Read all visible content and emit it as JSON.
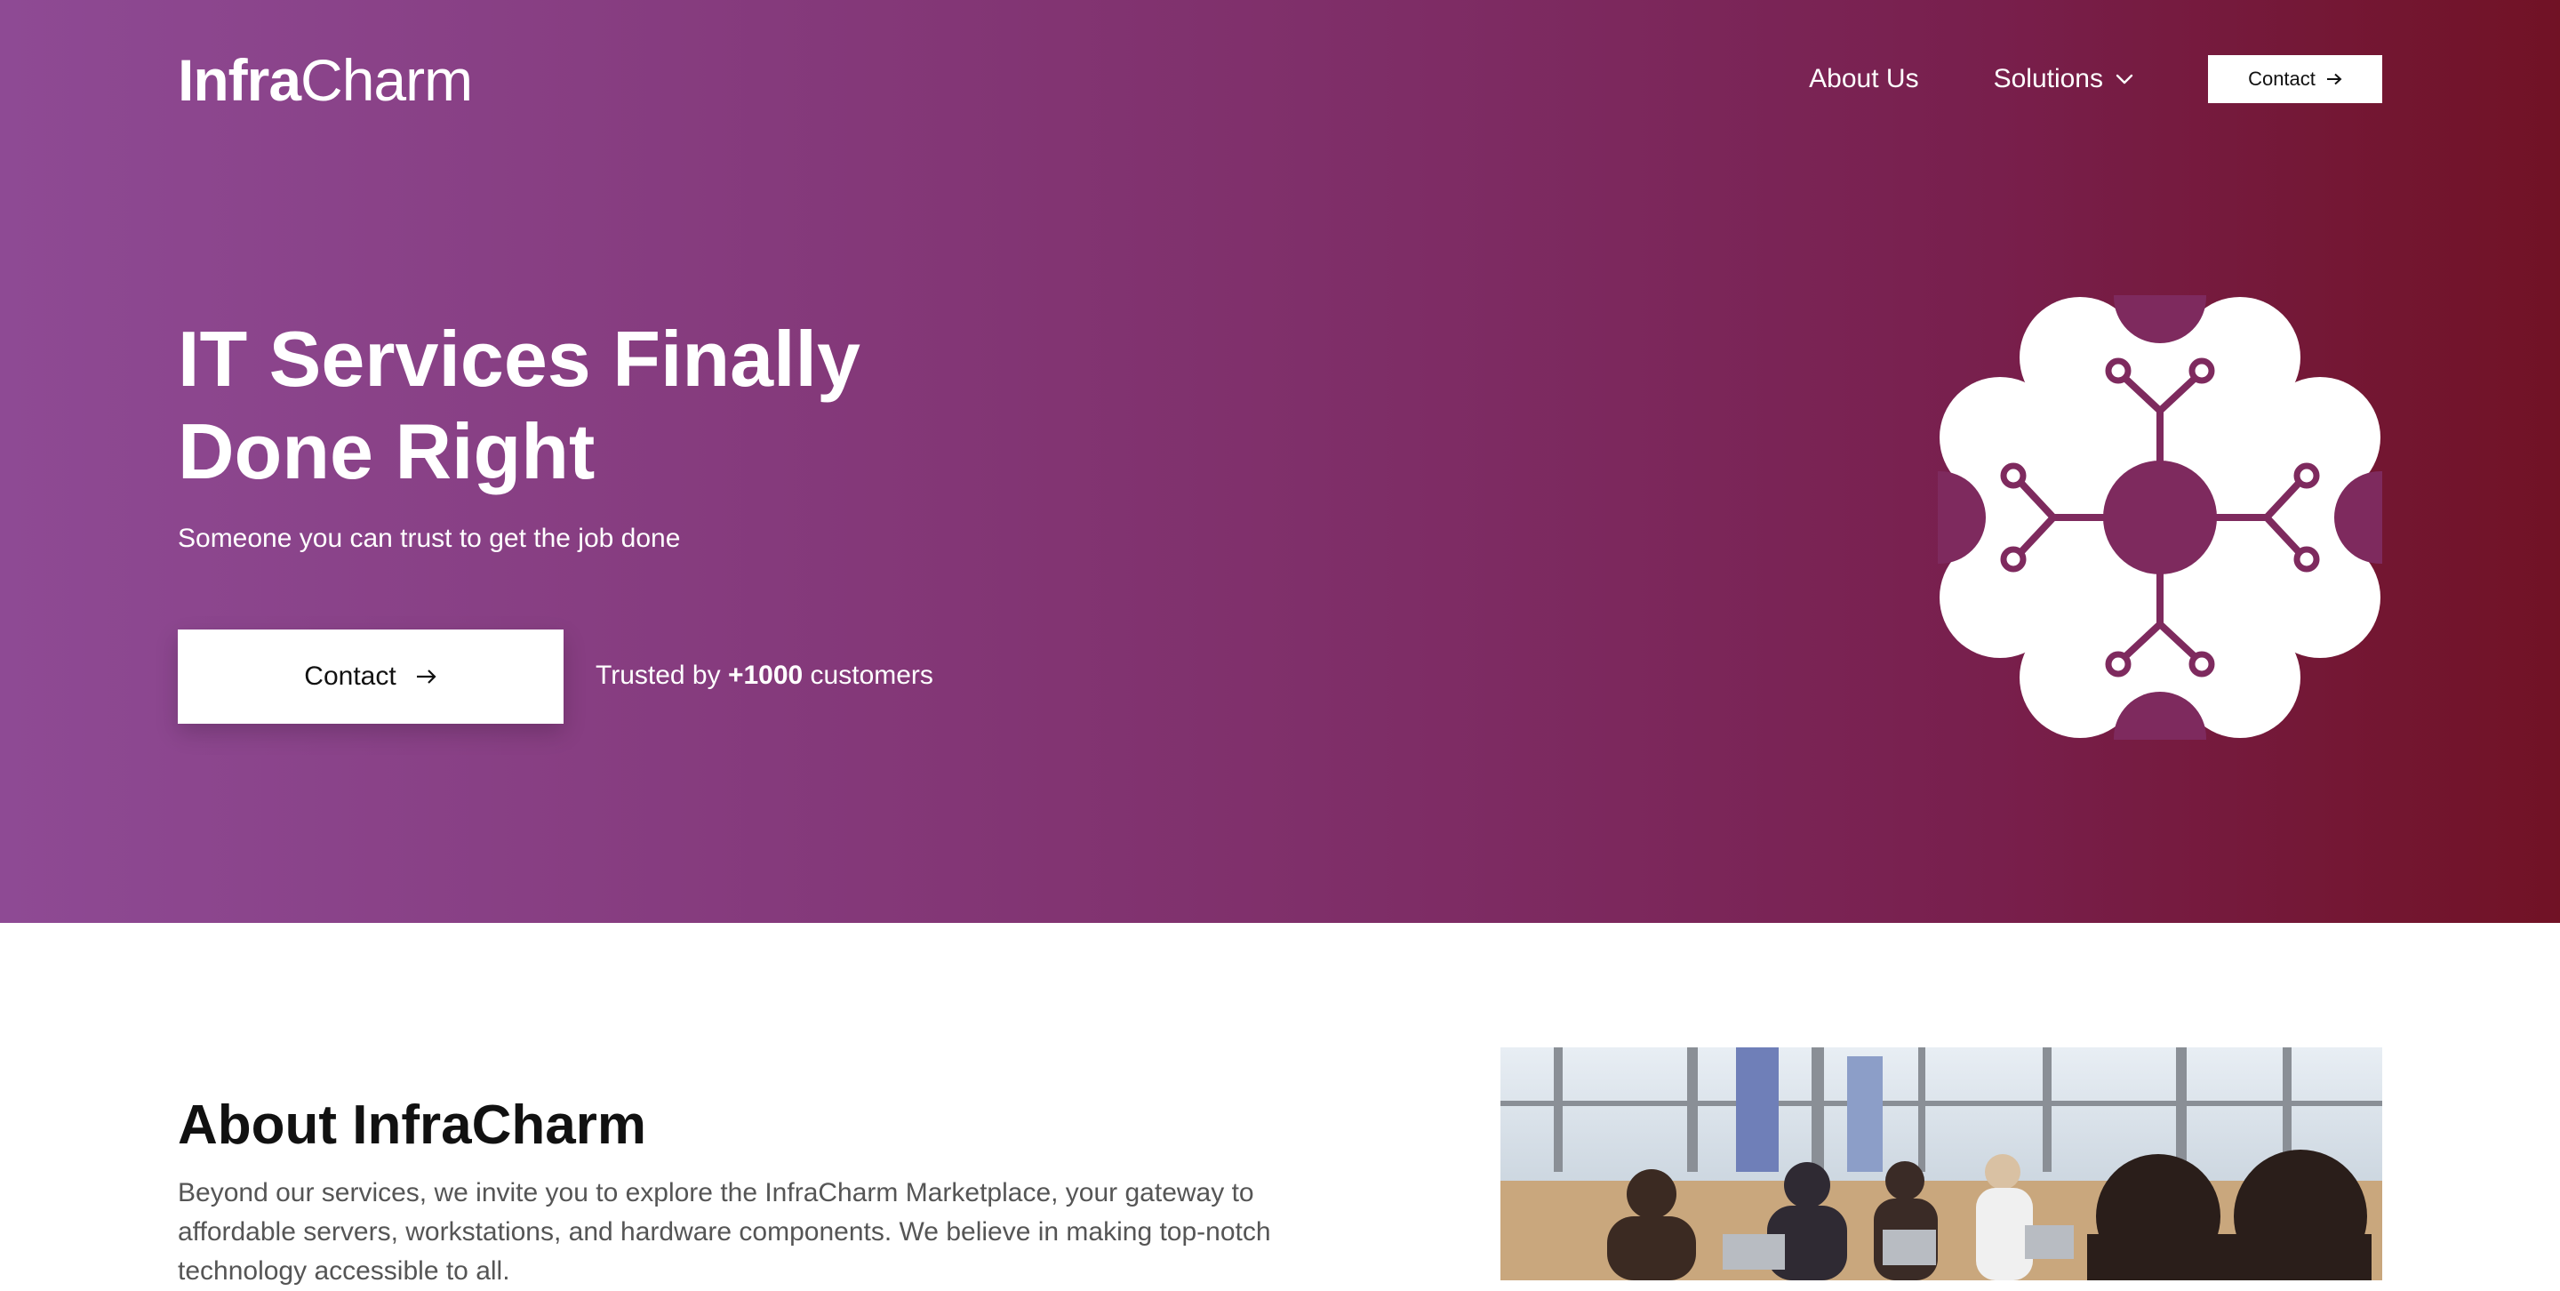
{
  "brand": {
    "logo_bold": "Infra",
    "logo_light": "Charm"
  },
  "nav": {
    "about": "About Us",
    "solutions": "Solutions",
    "contact": "Contact"
  },
  "hero": {
    "title_line1": "IT Services Finally",
    "title_line2": "Done Right",
    "subtitle": "Someone you can trust to get the job done",
    "cta_label": "Contact",
    "trusted_prefix": "Trusted by ",
    "trusted_count": "+1000",
    "trusted_suffix": " customers"
  },
  "about": {
    "title": "About InfraCharm",
    "text": "Beyond our services, we invite you to explore the InfraCharm Marketplace, your gateway to affordable servers, workstations, and hardware components. We believe in making top-notch technology accessible to all."
  },
  "icons": {
    "solutions_chevron": "chevron-down-icon",
    "arrow": "arrow-right-icon",
    "emblem": "circuit-flower-icon"
  },
  "colors": {
    "gradient_start": "#8e4a94",
    "gradient_end": "#711225",
    "accent": "#7a1f45",
    "white": "#ffffff"
  }
}
